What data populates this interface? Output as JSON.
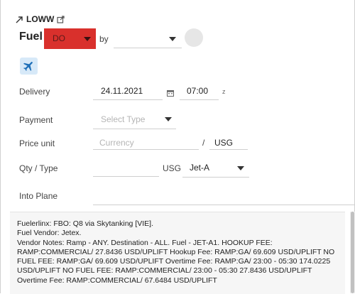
{
  "header": {
    "airport_code": "LOWW",
    "fuel_label": "Fuel",
    "fuel_dropdown_value": "DO",
    "by_label": "by",
    "by_value": ""
  },
  "form": {
    "delivery": {
      "label": "Delivery",
      "date": "24.11.2021",
      "time": "07:00",
      "tz": "z"
    },
    "payment": {
      "label": "Payment",
      "placeholder": "Select Type"
    },
    "price_unit": {
      "label": "Price unit",
      "currency_placeholder": "Currency",
      "separator": "/",
      "unit": "USG"
    },
    "qty_type": {
      "label": "Qty / Type",
      "quantity": "",
      "unit": "USG",
      "fuel_type": "Jet-A"
    },
    "into_plane": {
      "label": "Into Plane",
      "value": ""
    }
  },
  "notes": {
    "text": "Fuelerlinx: FBO: Q8 via Skytanking [VIE].\n Fuel Vendor: Jetex.\n Vendor Notes: Ramp - ANY. Destination - ALL. Fuel - JET-A1. HOOKUP FEE: RAMP:COMMERCIAL/  27.8436 USD/UPLIFT Hookup Fee: RAMP:GA/  69.609 USD/UPLIFT NO FUEL FEE: RAMP:GA/  69.609 USD/UPLIFT Overtime Fee: RAMP:GA/ 23:00 - 05:30 174.0225 USD/UPLIFT NO FUEL FEE: RAMP:COMMERCIAL/ 23:00 - 05:30 27.8436 USD/UPLIFT Overtime Fee: RAMP:COMMERCIAL/  67.6484 USD/UPLIFT"
  },
  "icons": {
    "link": "arrow-up-right-icon",
    "external": "external-link-icon",
    "plane": "airplane-icon",
    "calendar": "calendar-icon"
  },
  "colors": {
    "fuel_dropdown_bg": "#d9302c",
    "plane_button_bg": "#d7e9f8",
    "plane_icon": "#1e6fb8"
  }
}
